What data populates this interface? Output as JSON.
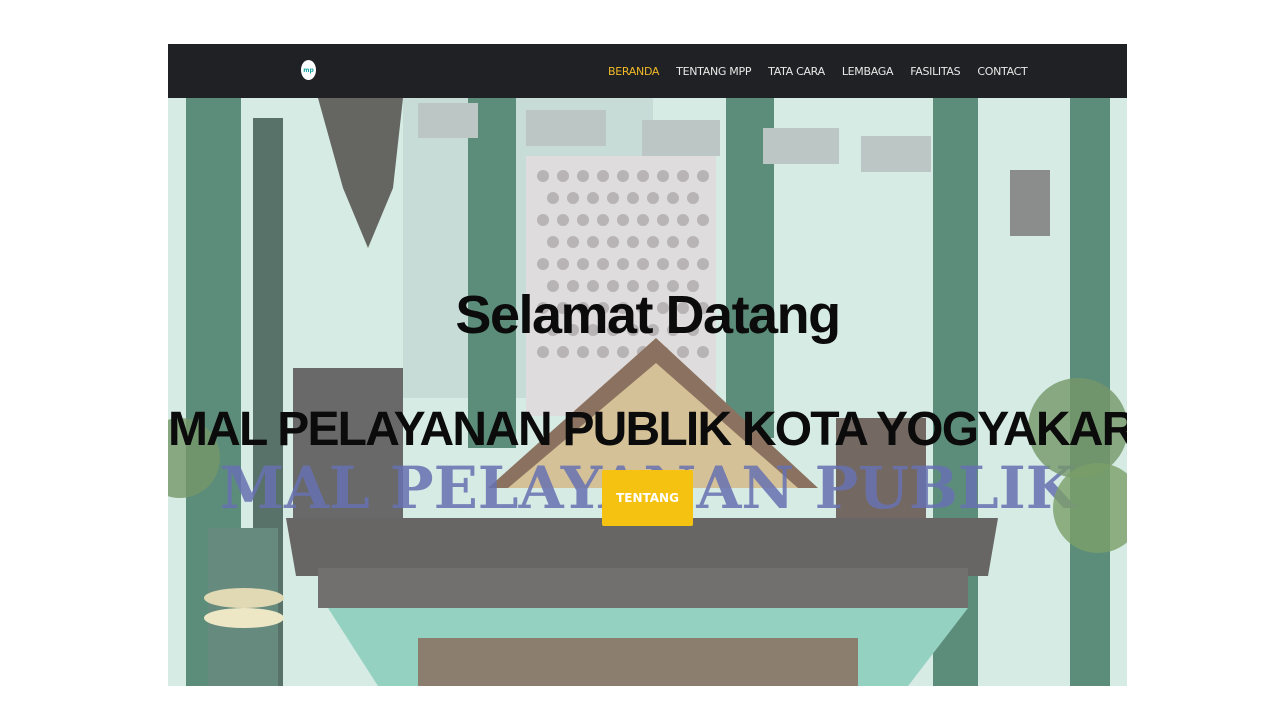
{
  "navbar": {
    "logo_text": "mp",
    "items": [
      {
        "label": "BERANDA",
        "active": true
      },
      {
        "label": "TENTANG MPP",
        "active": false
      },
      {
        "label": "TATA CARA",
        "active": false
      },
      {
        "label": "LEMBAGA",
        "active": false
      },
      {
        "label": "FASILITAS",
        "active": false
      },
      {
        "label": "CONTACT",
        "active": false
      }
    ]
  },
  "hero": {
    "title": "Selamat Datang",
    "subtitle": "MAL PELAYANAN PUBLIK KOTA YOGYAKARTA",
    "cta_label": "TENTANG",
    "building_sign": "MAL PELAYANAN PUBLIK"
  },
  "colors": {
    "navbar_bg": "#1f2124",
    "nav_active": "#f1b828",
    "cta_bg": "#f5c211",
    "building_green": "#2e6e57",
    "building_mint": "#bfe3d9"
  }
}
